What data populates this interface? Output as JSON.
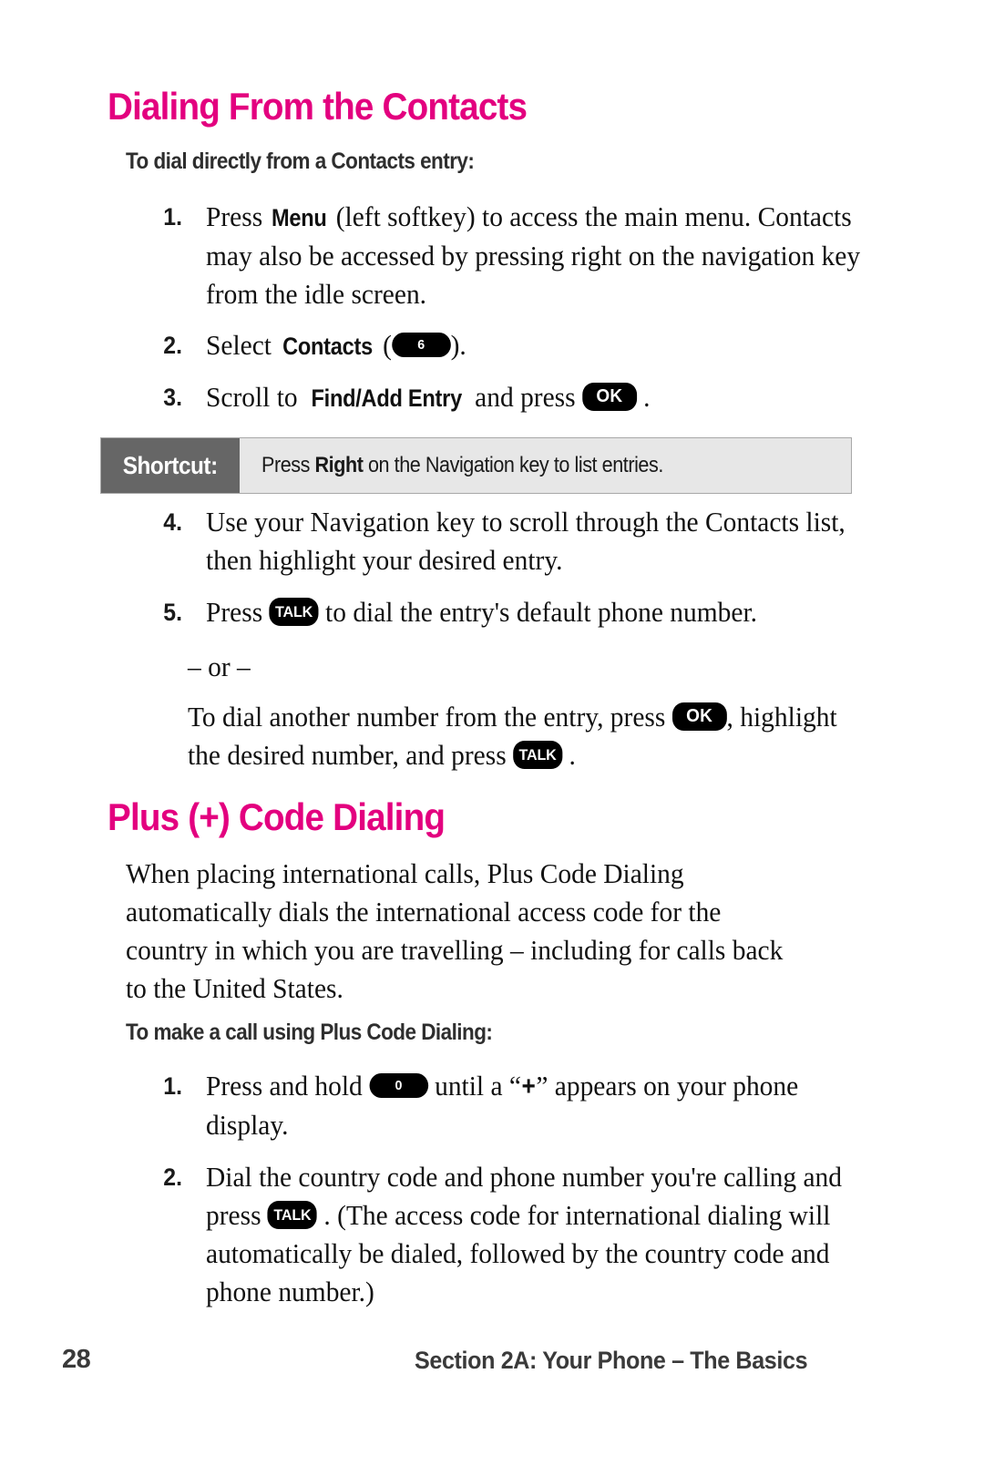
{
  "colors": {
    "heading_magenta": "#E3007F",
    "shortcut_label_bg": "#666666",
    "shortcut_body_bg": "#E7E7E7",
    "key_pill_bg": "#000000",
    "body_text": "#111111"
  },
  "section_1": {
    "heading": "Dialing From the Contacts",
    "subheading": "To dial directly from a Contacts entry:",
    "steps": [
      {
        "number": "1.",
        "text_before": "Press ",
        "bold": "Menu",
        "text_after": " (left softkey) to access the main menu. Contacts may also be accessed by pressing right on the navigation key from the idle screen."
      },
      {
        "number": "2.",
        "text_before": "Select ",
        "bold": "Contacts",
        "paren_open": " (",
        "key": "6",
        "paren_close": ")."
      },
      {
        "number": "3.",
        "text_before": "Scroll to ",
        "bold": "Find/Add Entry",
        "text_mid": " and press ",
        "key": "OK",
        "text_after": " ."
      },
      {
        "number": "4.",
        "text": "Use your Navigation key to scroll through the Contacts list, then highlight your desired entry."
      },
      {
        "number": "5.",
        "text_before": "Press ",
        "key": "TALK",
        "text_after": " to dial the entry's default phone number."
      }
    ],
    "or_divider": "– or –",
    "alt_paragraph": {
      "text_before": "To dial another number from the entry, press ",
      "key_1": "OK",
      "text_mid": ", highlight the desired number, and press ",
      "key_2": "TALK",
      "text_after": " ."
    }
  },
  "shortcut": {
    "label": "Shortcut:",
    "text_before": "Press ",
    "bold": "Right",
    "text_after": " on the Navigation key to list entries."
  },
  "section_2": {
    "heading": "Plus (+) Code Dialing",
    "paragraph": "When placing international calls, Plus Code Dialing automatically dials the international access code for the country in which you are travelling – including for calls back to the United States.",
    "subheading": "To make a call using Plus Code Dialing:",
    "steps": [
      {
        "number": "1.",
        "text_before": "Press and hold ",
        "key": "0",
        "text_mid": " until a “",
        "bold_symbol": "+",
        "text_after": "” appears on your phone display."
      },
      {
        "number": "2.",
        "text_before": "Dial the country code and phone number you're calling and press ",
        "key": "TALK",
        "text_after": " . (The access code for international dialing will automatically be dialed, followed by the country code and phone number.)"
      }
    ]
  },
  "footer": {
    "page_number": "28",
    "section_label": "Section 2A: Your Phone – The Basics"
  }
}
